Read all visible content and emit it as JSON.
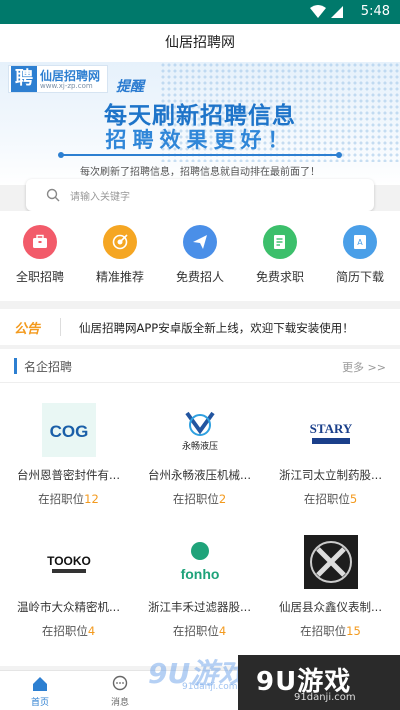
{
  "status_bar": {
    "time": "5:48",
    "wifi_icon": "wifi-icon",
    "battery_icon": "battery-icon"
  },
  "app": {
    "title": "仙居招聘网"
  },
  "banner": {
    "logo_char": "聘",
    "logo_name": "仙居招聘网",
    "logo_url": "www.xj-zp.com",
    "tag": "提醒",
    "headline": "每天刷新招聘信息",
    "subline": "招聘效果更好！",
    "note": "每次刷新了招聘信息，招聘信息就自动排在最前面了！"
  },
  "search": {
    "placeholder": "请输入关键字",
    "icon": "search-icon"
  },
  "quick_actions": [
    {
      "label": "全职招聘",
      "icon": "briefcase-icon",
      "color": "#f25b6a"
    },
    {
      "label": "精准推荐",
      "icon": "target-icon",
      "color": "#f5a623"
    },
    {
      "label": "免费招人",
      "icon": "paper-plane-icon",
      "color": "#4a8fe8"
    },
    {
      "label": "免费求职",
      "icon": "resume-icon",
      "color": "#3cbf6b"
    },
    {
      "label": "简历下载",
      "icon": "document-download-icon",
      "color": "#4a9fe8"
    }
  ],
  "notice": {
    "tag": "公告",
    "text": "仙居招聘网APP安卓版全新上线，欢迎下载安装使用！"
  },
  "companies": {
    "title": "名企招聘",
    "more": "更多 >>",
    "count_prefix": "在招职位",
    "items": [
      {
        "name": "台州恩普密封件有...",
        "count": "12",
        "logo_text": "COG"
      },
      {
        "name": "台州永畅液压机械...",
        "count": "2",
        "logo_text": "永畅液压"
      },
      {
        "name": "浙江司太立制药股...",
        "count": "5",
        "logo_text": "STARY"
      },
      {
        "name": "温岭市大众精密机...",
        "count": "4",
        "logo_text": "TOOKO"
      },
      {
        "name": "浙江丰禾过滤器股...",
        "count": "4",
        "logo_text": "fonho"
      },
      {
        "name": "仙居县众鑫仪表制...",
        "count": "15",
        "logo_text": ""
      }
    ]
  },
  "tabbar": [
    {
      "label": "首页",
      "icon": "home-icon",
      "active": true
    },
    {
      "label": "消息",
      "icon": "message-icon",
      "active": false
    }
  ],
  "watermark": {
    "left_big": "9U游戏",
    "left_small": "91danji.com",
    "right_big": "9U游戏",
    "right_small": "91danji.com"
  }
}
